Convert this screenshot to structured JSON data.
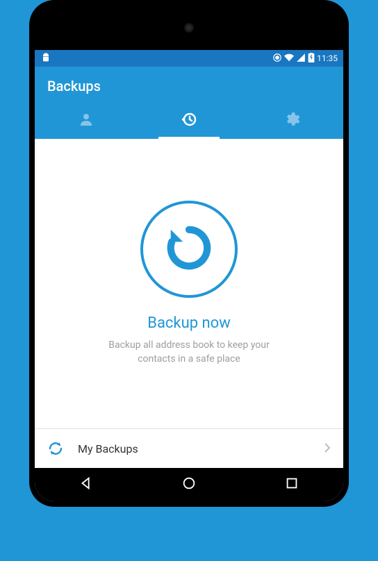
{
  "status": {
    "time": "11:35"
  },
  "header": {
    "title": "Backups"
  },
  "hero": {
    "title": "Backup now",
    "subtitle": "Backup all address book to keep your contacts in a safe place"
  },
  "list": {
    "my_backups_label": "My Backups"
  },
  "colors": {
    "primary": "#2196d6",
    "primary_dark": "#1976c0"
  }
}
